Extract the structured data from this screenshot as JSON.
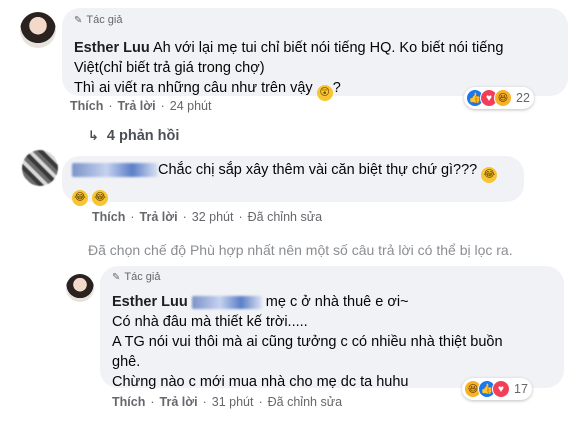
{
  "comment1": {
    "author_tag": "Tác giả",
    "author": "Esther Luu",
    "line1": "Ah với lại mẹ tui chỉ biết nói tiếng HQ. Ko biết nói tiếng",
    "line2": "Việt(chỉ biết trả giá trong chợ)",
    "line3": "Thì ai viết ra những câu như trên vậy",
    "line3_end": "?",
    "actions": [
      "Thích",
      "Trả lời",
      "24 phút"
    ],
    "reactions": {
      "icons": [
        "like-icon",
        "love-icon",
        "haha-icon"
      ],
      "count": "22"
    },
    "replies_label": "4 phản hồi"
  },
  "comment2": {
    "text_line1": "Chắc chị sắp xây thêm vài căn biệt thự chứ gì???",
    "actions": [
      "Thích",
      "Trả lời",
      "32 phút",
      "Đã chỉnh sửa"
    ]
  },
  "filter_notice": "Đã chọn chế độ Phù hợp nhất nên một số câu trả lời có thể bị lọc ra.",
  "reply": {
    "author_tag": "Tác giả",
    "author": "Esther Luu",
    "line1_tail": "mẹ c ở nhà thuê e ơi~",
    "line2": "Có nhà đâu mà thiết kế trời.....",
    "line3": "A TG nói vui thôi mà ai cũng tưởng c có nhiều nhà thiệt buồn",
    "line4": "ghê.",
    "line5": "Chừng nào c mới mua nhà cho mẹ dc ta huhu",
    "actions": [
      "Thích",
      "Trả lời",
      "31 phút",
      "Đã chỉnh sửa"
    ],
    "reactions": {
      "icons": [
        "haha-icon",
        "like-icon",
        "love-icon"
      ],
      "count": "17"
    }
  },
  "colors": {
    "bubble": "#f0f2f5",
    "like": "#1877f2",
    "love": "#f33e58",
    "haha": "#f7b125",
    "muted": "#65676b"
  }
}
